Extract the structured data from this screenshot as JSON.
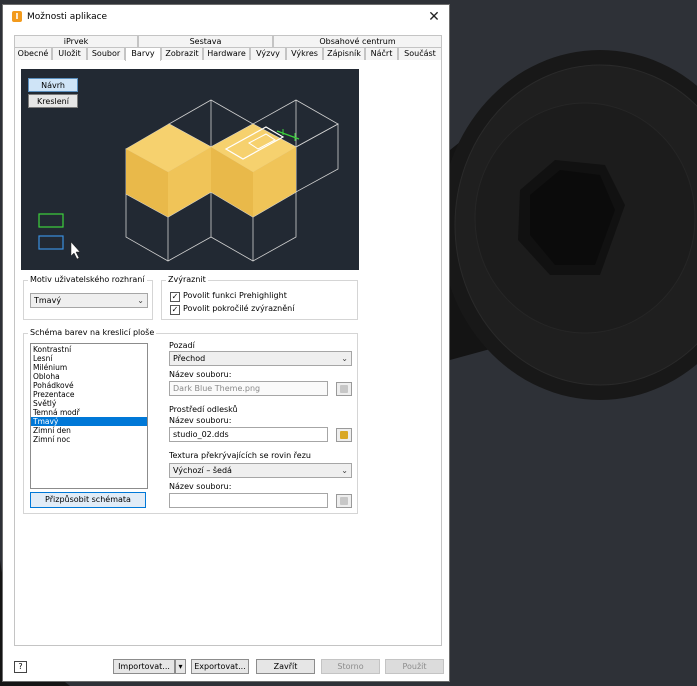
{
  "window": {
    "title": "Možnosti aplikace",
    "close_glyph": "✕",
    "icon_letter": "I"
  },
  "tabs_top": [
    "iPrvek",
    "Sestava",
    "Obsahové centrum"
  ],
  "tabs_bottom": [
    "Obecné",
    "Uložit",
    "Soubor",
    "Barvy",
    "Zobrazit",
    "Hardware",
    "Výzvy",
    "Výkres",
    "Zápisník",
    "Náčrt",
    "Součást"
  ],
  "active_tab": "Barvy",
  "preview": {
    "design_label": "Návrh",
    "drawing_label": "Kreslení"
  },
  "ui_theme": {
    "label": "Motiv uživatelského rozhraní",
    "value": "Tmavý"
  },
  "highlight": {
    "label": "Zvýraznit",
    "prehighlight": "Povolit funkci Prehighlight",
    "enhanced": "Povolit pokročilé zvýraznění"
  },
  "schemes": {
    "label": "Schéma barev na kreslicí ploše",
    "items": [
      "Kontrastní",
      "Lesní",
      "Milénium",
      "Obloha",
      "Pohádkové",
      "Prezentace",
      "Světlý",
      "Temná modř",
      "Tmavý",
      "Zimní den",
      "Zimní noc"
    ],
    "selected": "Tmavý",
    "customize": "Přizpůsobit schémata"
  },
  "background": {
    "label": "Pozadí",
    "value": "Přechod",
    "filename_label": "Název souboru:",
    "filename": "Dark Blue Theme.png"
  },
  "reflection": {
    "label": "Prostředí odlesků",
    "filename_label": "Název souboru:",
    "filename": "studio_02.dds"
  },
  "section_texture": {
    "label": "Textura překrývajících se rovin řezu",
    "value": "Výchozí – šedá",
    "filename_label": "Název souboru:",
    "filename": ""
  },
  "footer": {
    "help": "?",
    "import": "Importovat...",
    "export": "Exportovat...",
    "close": "Zavřít",
    "cancel": "Storno",
    "apply": "Použít"
  },
  "colors": {
    "accent": "#0078d7",
    "cube_fill": "#f2c250",
    "preview_bg": "#222933",
    "highlight_green": "#3cd13c",
    "select_blue": "#3a8fe0"
  }
}
